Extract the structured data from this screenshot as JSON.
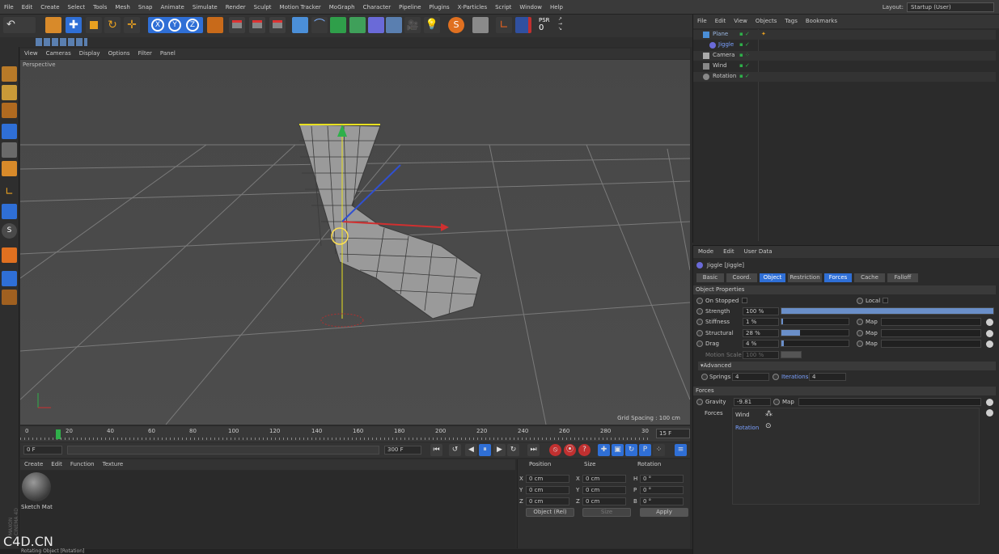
{
  "menu": [
    "File",
    "Edit",
    "Create",
    "Select",
    "Tools",
    "Mesh",
    "Snap",
    "Animate",
    "Simulate",
    "Render",
    "Sculpt",
    "Motion Tracker",
    "MoGraph",
    "Character",
    "Pipeline",
    "Plugins",
    "X-Particles",
    "Script",
    "Window",
    "Help"
  ],
  "layout": {
    "label": "Layout:",
    "value": "Startup (User)"
  },
  "toolbar": {
    "psr_label": "PSR",
    "psr_value": "0"
  },
  "viewport": {
    "menu": [
      "View",
      "Cameras",
      "Display",
      "Options",
      "Filter",
      "Panel"
    ],
    "label": "Perspective",
    "grid_spacing": "Grid Spacing : 100 cm"
  },
  "timeline": {
    "ticks": [
      "0",
      "20",
      "40",
      "60",
      "80",
      "100",
      "120",
      "140",
      "160",
      "180",
      "200",
      "220",
      "240",
      "260",
      "280",
      "30"
    ],
    "current_frame": "15 F",
    "start_field": "0 F",
    "end_field": "300 F"
  },
  "material_manager": {
    "menu": [
      "Create",
      "Edit",
      "Function",
      "Texture"
    ],
    "material_name": "Sketch Mat"
  },
  "coordinates": {
    "headers": {
      "position": "Position",
      "size": "Size",
      "rotation": "Rotation"
    },
    "rows": [
      {
        "axis": "X",
        "pos": "0 cm",
        "size_axis": "X",
        "size": "0 cm",
        "rot_axis": "H",
        "rot": "0 °"
      },
      {
        "axis": "Y",
        "pos": "0 cm",
        "size_axis": "Y",
        "size": "0 cm",
        "rot_axis": "P",
        "rot": "0 °"
      },
      {
        "axis": "Z",
        "pos": "0 cm",
        "size_axis": "Z",
        "size": "0 cm",
        "rot_axis": "B",
        "rot": "0 °"
      }
    ],
    "mode_select": "Object (Rel)",
    "size_select": "Size",
    "apply_label": "Apply"
  },
  "object_manager": {
    "menu": [
      "File",
      "Edit",
      "View",
      "Objects",
      "Tags",
      "Bookmarks"
    ],
    "objects": [
      {
        "name": "Plane",
        "color": "#9ab6e0"
      },
      {
        "name": "Jiggle",
        "color": "#7aa0ff"
      },
      {
        "name": "Camera",
        "color": "#c8c8c8"
      },
      {
        "name": "Wind",
        "color": "#c8c8c8"
      },
      {
        "name": "Rotation",
        "color": "#c8c8c8"
      }
    ]
  },
  "attribute_manager": {
    "menu": [
      "Mode",
      "Edit",
      "User Data"
    ],
    "title": "Jiggle [Jiggle]",
    "tabs": [
      "Basic",
      "Coord.",
      "Object",
      "Restriction",
      "Forces",
      "Cache",
      "Falloff"
    ],
    "active_tabs": [
      "Object",
      "Forces"
    ],
    "object_properties": {
      "section": "Object Properties",
      "on_stopped": "On Stopped",
      "local": "Local",
      "strength_label": "Strength",
      "strength": "100 %",
      "strength_level": 1.0,
      "stiffness_label": "Stiffness",
      "stiffness": "1 %",
      "stiffness_level": 0.01,
      "structural_label": "Structural",
      "structural": "28 %",
      "structural_level": 0.28,
      "drag_label": "Drag",
      "drag": "4 %",
      "drag_level": 0.04,
      "motion_scale_label": "Motion Scale",
      "motion_scale": "100 %",
      "map_label": "Map",
      "advanced": "Advanced",
      "springs_label": "Springs",
      "springs": "4",
      "iterations_label": "Iterations",
      "iterations": "4"
    },
    "forces": {
      "section": "Forces",
      "gravity_label": "Gravity",
      "gravity": "-9.81",
      "map_label": "Map",
      "forces_label": "Forces",
      "list": [
        "Wind",
        "Rotation"
      ]
    }
  },
  "status_text": "Rotating Object [Rotation]",
  "watermark": "C4D.CN",
  "maxon_text": "MAXON CINEMA 4D"
}
